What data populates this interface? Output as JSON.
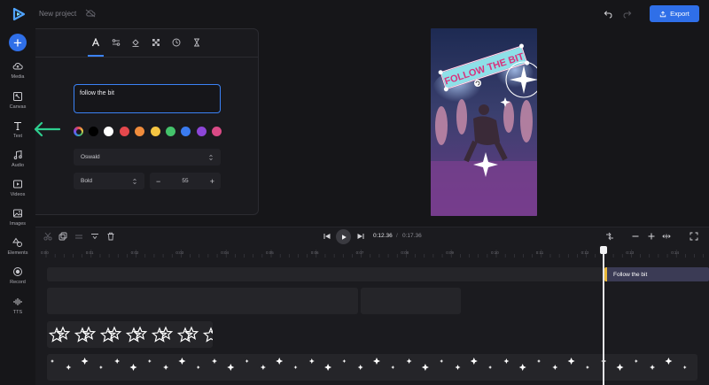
{
  "app": {
    "project_title": "New project",
    "export_label": "Export"
  },
  "sidebar": {
    "items": [
      {
        "label": "Media",
        "icon": "cloud-upload-icon"
      },
      {
        "label": "Canvas",
        "icon": "canvas-resize-icon"
      },
      {
        "label": "Text",
        "icon": "text-icon"
      },
      {
        "label": "Audio",
        "icon": "music-note-icon"
      },
      {
        "label": "Videos",
        "icon": "video-icon"
      },
      {
        "label": "Images",
        "icon": "image-icon"
      },
      {
        "label": "Elements",
        "icon": "shapes-icon"
      },
      {
        "label": "Record",
        "icon": "record-icon"
      },
      {
        "label": "TTS",
        "icon": "waveform-icon"
      }
    ]
  },
  "panel": {
    "tabs": [
      "text-tab-icon",
      "adjust-icon",
      "fill-icon",
      "transparency-icon",
      "timing-icon",
      "hourglass-icon"
    ],
    "text_value": "follow the bit",
    "colors": [
      "#000000",
      "#ffffff",
      "#e5484d",
      "#f08c3c",
      "#f5c542",
      "#44c36b",
      "#3a7bf0",
      "#8d46d8",
      "#d94a86"
    ],
    "font": "Oswald",
    "weight": "Bold",
    "size": "55",
    "minus": "−",
    "plus": "+"
  },
  "preview": {
    "overlay_text": "FOLLOW THE BIT"
  },
  "timeline": {
    "current_time": "0:12.36",
    "separator": "/",
    "duration": "0:17.36",
    "ticks": [
      "0:00",
      "0:01",
      "0:02",
      "0:03",
      "0:04",
      "0:05",
      "0:06",
      "0:07",
      "0:08",
      "0:09",
      "0:10",
      "0:11",
      "0:12",
      "0:13",
      "0:14"
    ],
    "text_clip_label": "Follow the bit",
    "playhead_fraction": 0.712
  },
  "colors": {
    "accent": "#2f6fe8",
    "arrow": "#2ecf8f",
    "clip_handle": "#e8b73a"
  }
}
